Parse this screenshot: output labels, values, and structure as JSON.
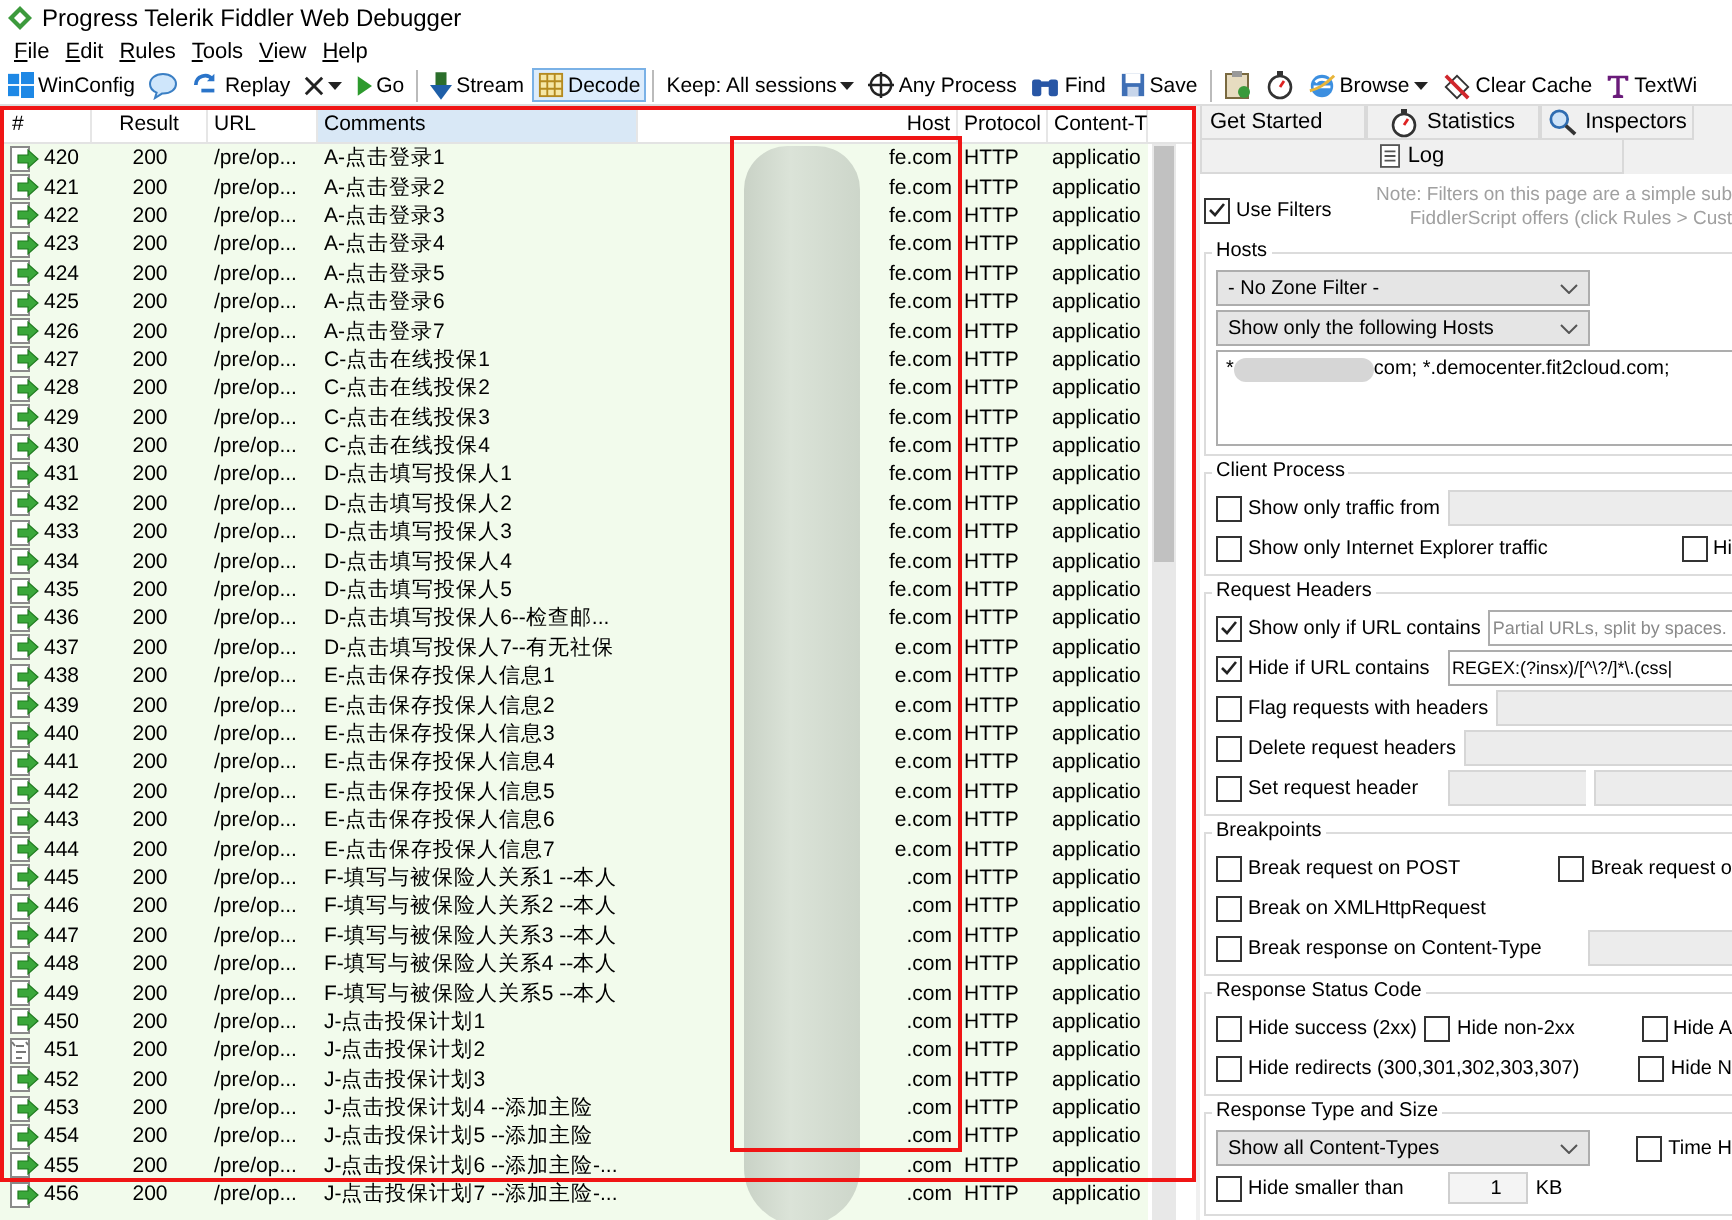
{
  "window": {
    "title": "Progress Telerik Fiddler Web Debugger"
  },
  "menu": [
    "File",
    "Edit",
    "Rules",
    "Tools",
    "View",
    "Help"
  ],
  "toolbar": [
    {
      "kind": "button",
      "label": "WinConfig",
      "dropdown": false,
      "selected": false
    },
    {
      "kind": "button",
      "dropdown": false,
      "selected": false
    },
    {
      "kind": "button",
      "label": "Replay",
      "dropdown": false,
      "selected": false
    },
    {
      "kind": "button",
      "dropdown": true,
      "selected": false
    },
    {
      "kind": "button",
      "label": "Go",
      "dropdown": false,
      "selected": false
    },
    {
      "kind": "separator"
    },
    {
      "kind": "button",
      "label": "Stream",
      "dropdown": false,
      "selected": false
    },
    {
      "kind": "button",
      "label": "Decode",
      "dropdown": false,
      "selected": true
    },
    {
      "kind": "separator"
    },
    {
      "kind": "button",
      "label": "Keep: All sessions",
      "dropdown": true,
      "selected": false
    },
    {
      "kind": "button",
      "label": "Any Process",
      "dropdown": false,
      "selected": false
    },
    {
      "kind": "button",
      "label": "Find",
      "dropdown": false,
      "selected": false
    },
    {
      "kind": "button",
      "label": "Save",
      "dropdown": false,
      "selected": false
    },
    {
      "kind": "separator"
    },
    {
      "kind": "button",
      "dropdown": false,
      "selected": false
    },
    {
      "kind": "button",
      "dropdown": false,
      "selected": false
    },
    {
      "kind": "button",
      "label": "Browse",
      "dropdown": true,
      "selected": false
    },
    {
      "kind": "button",
      "label": "Clear Cache",
      "dropdown": false,
      "selected": false
    },
    {
      "kind": "button",
      "label": "TextWi",
      "dropdown": false,
      "selected": false
    }
  ],
  "sessions": {
    "columns": [
      {
        "label": "#",
        "selected": false
      },
      {
        "label": "Result",
        "selected": false
      },
      {
        "label": "URL",
        "selected": false
      },
      {
        "label": "Comments",
        "selected": true
      },
      {
        "label": "Host",
        "selected": false
      },
      {
        "label": "Protocol",
        "selected": false
      },
      {
        "label": "Content-T",
        "selected": false
      }
    ],
    "rows": [
      {
        "kind": "arrow",
        "id": "420",
        "result": "200",
        "url": "/pre/op...",
        "comment": "A-点击登录1",
        "host": "fe.com",
        "protocol": "HTTP",
        "content_type": "applicatio"
      },
      {
        "kind": "arrow",
        "id": "421",
        "result": "200",
        "url": "/pre/op...",
        "comment": "A-点击登录2",
        "host": "fe.com",
        "protocol": "HTTP",
        "content_type": "applicatio"
      },
      {
        "kind": "arrow",
        "id": "422",
        "result": "200",
        "url": "/pre/op...",
        "comment": "A-点击登录3",
        "host": "fe.com",
        "protocol": "HTTP",
        "content_type": "applicatio"
      },
      {
        "kind": "arrow",
        "id": "423",
        "result": "200",
        "url": "/pre/op...",
        "comment": "A-点击登录4",
        "host": "fe.com",
        "protocol": "HTTP",
        "content_type": "applicatio"
      },
      {
        "kind": "arrow",
        "id": "424",
        "result": "200",
        "url": "/pre/op...",
        "comment": "A-点击登录5",
        "host": "fe.com",
        "protocol": "HTTP",
        "content_type": "applicatio"
      },
      {
        "kind": "arrow",
        "id": "425",
        "result": "200",
        "url": "/pre/op...",
        "comment": "A-点击登录6",
        "host": "fe.com",
        "protocol": "HTTP",
        "content_type": "applicatio"
      },
      {
        "kind": "arrow",
        "id": "426",
        "result": "200",
        "url": "/pre/op...",
        "comment": "A-点击登录7",
        "host": "fe.com",
        "protocol": "HTTP",
        "content_type": "applicatio"
      },
      {
        "kind": "arrow",
        "id": "427",
        "result": "200",
        "url": "/pre/op...",
        "comment": "C-点击在线投保1",
        "host": "fe.com",
        "protocol": "HTTP",
        "content_type": "applicatio"
      },
      {
        "kind": "arrow",
        "id": "428",
        "result": "200",
        "url": "/pre/op...",
        "comment": "C-点击在线投保2",
        "host": "fe.com",
        "protocol": "HTTP",
        "content_type": "applicatio"
      },
      {
        "kind": "arrow",
        "id": "429",
        "result": "200",
        "url": "/pre/op...",
        "comment": "C-点击在线投保3",
        "host": "fe.com",
        "protocol": "HTTP",
        "content_type": "applicatio"
      },
      {
        "kind": "arrow",
        "id": "430",
        "result": "200",
        "url": "/pre/op...",
        "comment": "C-点击在线投保4",
        "host": "fe.com",
        "protocol": "HTTP",
        "content_type": "applicatio"
      },
      {
        "kind": "arrow",
        "id": "431",
        "result": "200",
        "url": "/pre/op...",
        "comment": "D-点击填写投保人1",
        "host": "fe.com",
        "protocol": "HTTP",
        "content_type": "applicatio"
      },
      {
        "kind": "arrow",
        "id": "432",
        "result": "200",
        "url": "/pre/op...",
        "comment": "D-点击填写投保人2",
        "host": "fe.com",
        "protocol": "HTTP",
        "content_type": "applicatio"
      },
      {
        "kind": "arrow",
        "id": "433",
        "result": "200",
        "url": "/pre/op...",
        "comment": "D-点击填写投保人3",
        "host": "fe.com",
        "protocol": "HTTP",
        "content_type": "applicatio"
      },
      {
        "kind": "arrow",
        "id": "434",
        "result": "200",
        "url": "/pre/op...",
        "comment": "D-点击填写投保人4",
        "host": "fe.com",
        "protocol": "HTTP",
        "content_type": "applicatio"
      },
      {
        "kind": "arrow",
        "id": "435",
        "result": "200",
        "url": "/pre/op...",
        "comment": "D-点击填写投保人5",
        "host": "fe.com",
        "protocol": "HTTP",
        "content_type": "applicatio"
      },
      {
        "kind": "arrow",
        "id": "436",
        "result": "200",
        "url": "/pre/op...",
        "comment": "D-点击填写投保人6--检查邮...",
        "host": "fe.com",
        "protocol": "HTTP",
        "content_type": "applicatio"
      },
      {
        "kind": "arrow",
        "id": "437",
        "result": "200",
        "url": "/pre/op...",
        "comment": "D-点击填写投保人7--有无社保",
        "host": "e.com",
        "protocol": "HTTP",
        "content_type": "applicatio"
      },
      {
        "kind": "arrow",
        "id": "438",
        "result": "200",
        "url": "/pre/op...",
        "comment": "E-点击保存投保人信息1",
        "host": "e.com",
        "protocol": "HTTP",
        "content_type": "applicatio"
      },
      {
        "kind": "arrow",
        "id": "439",
        "result": "200",
        "url": "/pre/op...",
        "comment": "E-点击保存投保人信息2",
        "host": "e.com",
        "protocol": "HTTP",
        "content_type": "applicatio"
      },
      {
        "kind": "arrow",
        "id": "440",
        "result": "200",
        "url": "/pre/op...",
        "comment": "E-点击保存投保人信息3",
        "host": "e.com",
        "protocol": "HTTP",
        "content_type": "applicatio"
      },
      {
        "kind": "arrow",
        "id": "441",
        "result": "200",
        "url": "/pre/op...",
        "comment": "E-点击保存投保人信息4",
        "host": "e.com",
        "protocol": "HTTP",
        "content_type": "applicatio"
      },
      {
        "kind": "arrow",
        "id": "442",
        "result": "200",
        "url": "/pre/op...",
        "comment": "E-点击保存投保人信息5",
        "host": "e.com",
        "protocol": "HTTP",
        "content_type": "applicatio"
      },
      {
        "kind": "arrow",
        "id": "443",
        "result": "200",
        "url": "/pre/op...",
        "comment": "E-点击保存投保人信息6",
        "host": "e.com",
        "protocol": "HTTP",
        "content_type": "applicatio"
      },
      {
        "kind": "arrow",
        "id": "444",
        "result": "200",
        "url": "/pre/op...",
        "comment": "E-点击保存投保人信息7",
        "host": "e.com",
        "protocol": "HTTP",
        "content_type": "applicatio"
      },
      {
        "kind": "arrow",
        "id": "445",
        "result": "200",
        "url": "/pre/op...",
        "comment": "F-填写与被保险人关系1 --本人",
        "host": ".com",
        "protocol": "HTTP",
        "content_type": "applicatio"
      },
      {
        "kind": "arrow",
        "id": "446",
        "result": "200",
        "url": "/pre/op...",
        "comment": "F-填写与被保险人关系2 --本人",
        "host": ".com",
        "protocol": "HTTP",
        "content_type": "applicatio"
      },
      {
        "kind": "arrow",
        "id": "447",
        "result": "200",
        "url": "/pre/op...",
        "comment": "F-填写与被保险人关系3 --本人",
        "host": ".com",
        "protocol": "HTTP",
        "content_type": "applicatio"
      },
      {
        "kind": "arrow",
        "id": "448",
        "result": "200",
        "url": "/pre/op...",
        "comment": "F-填写与被保险人关系4 --本人",
        "host": ".com",
        "protocol": "HTTP",
        "content_type": "applicatio"
      },
      {
        "kind": "arrow",
        "id": "449",
        "result": "200",
        "url": "/pre/op...",
        "comment": "F-填写与被保险人关系5 --本人",
        "host": ".com",
        "protocol": "HTTP",
        "content_type": "applicatio"
      },
      {
        "kind": "arrow",
        "id": "450",
        "result": "200",
        "url": "/pre/op...",
        "comment": "J-点击投保计划1",
        "host": ".com",
        "protocol": "HTTP",
        "content_type": "applicatio"
      },
      {
        "kind": "script",
        "id": "451",
        "result": "200",
        "url": "/pre/op...",
        "comment": "J-点击投保计划2",
        "host": ".com",
        "protocol": "HTTP",
        "content_type": "applicatio"
      },
      {
        "kind": "arrow",
        "id": "452",
        "result": "200",
        "url": "/pre/op...",
        "comment": "J-点击投保计划3",
        "host": ".com",
        "protocol": "HTTP",
        "content_type": "applicatio"
      },
      {
        "kind": "arrow",
        "id": "453",
        "result": "200",
        "url": "/pre/op...",
        "comment": "J-点击投保计划4 --添加主险",
        "host": ".com",
        "protocol": "HTTP",
        "content_type": "applicatio"
      },
      {
        "kind": "arrow",
        "id": "454",
        "result": "200",
        "url": "/pre/op...",
        "comment": "J-点击投保计划5 --添加主险",
        "host": ".com",
        "protocol": "HTTP",
        "content_type": "applicatio"
      },
      {
        "kind": "arrow",
        "id": "455",
        "result": "200",
        "url": "/pre/op...",
        "comment": "J-点击投保计划6 --添加主险-...",
        "host": ".com",
        "protocol": "HTTP",
        "content_type": "applicatio"
      },
      {
        "kind": "arrow",
        "id": "456",
        "result": "200",
        "url": "/pre/op...",
        "comment": "J-点击投保计划7 --添加主险-...",
        "host": ".com",
        "protocol": "HTTP",
        "content_type": "applicatio"
      }
    ]
  },
  "inspector_tabs": [
    {
      "label": "Get Started"
    },
    {
      "label": "Statistics"
    },
    {
      "label": "Inspectors"
    },
    {
      "label": "Log"
    }
  ],
  "filters": {
    "use_filters": {
      "label": "Use Filters",
      "checked": true
    },
    "note": [
      "Note: Filters on this page are a simple sub",
      "FiddlerScript offers (click Rules > Cust"
    ],
    "groups": [
      {
        "title": "Hosts",
        "rows": [
          {
            "left": [
              {
                "kind": "select",
                "value": "- No Zone Filter -"
              }
            ]
          },
          {
            "left": [
              {
                "kind": "select",
                "value": "Show only the following Hosts"
              }
            ]
          },
          {
            "left": [
              {
                "kind": "textarea",
                "parts": [
                  "*",
                  "com; *.democenter.fit2cloud.com;"
                ]
              }
            ]
          }
        ]
      },
      {
        "title": "Client Process",
        "rows": [
          {
            "left": [
              {
                "kind": "checkbox",
                "label": "Show only traffic from",
                "checked": false
              },
              {
                "kind": "input",
                "disabled": true
              }
            ]
          },
          {
            "left": [
              {
                "kind": "checkbox",
                "label": "Show only Internet Explorer traffic",
                "checked": false
              }
            ],
            "right": [
              {
                "kind": "checkbox",
                "label": "Hi",
                "checked": false
              }
            ]
          }
        ]
      },
      {
        "title": "Request Headers",
        "rows": [
          {
            "left": [
              {
                "kind": "checkbox",
                "label": "Show only if URL contains",
                "checked": true
              },
              {
                "kind": "input",
                "placeholder": "Partial URLs, split by spaces.",
                "disabled": false
              }
            ]
          },
          {
            "left": [
              {
                "kind": "checkbox",
                "label": "Hide if URL contains",
                "checked": true
              },
              {
                "kind": "input",
                "value": "REGEX:(?insx)/[^\\?/]*\\.(css|",
                "disabled": false
              }
            ]
          },
          {
            "left": [
              {
                "kind": "checkbox",
                "label": "Flag requests with headers",
                "checked": false
              },
              {
                "kind": "input",
                "disabled": true
              }
            ]
          },
          {
            "left": [
              {
                "kind": "checkbox",
                "label": "Delete request headers",
                "checked": false
              },
              {
                "kind": "input",
                "disabled": true
              }
            ]
          },
          {
            "left": [
              {
                "kind": "checkbox",
                "label": "Set request header",
                "checked": false
              },
              {
                "kind": "input",
                "disabled": true
              },
              {
                "kind": "input",
                "disabled": true
              }
            ]
          }
        ]
      },
      {
        "title": "Breakpoints",
        "rows": [
          {
            "left": [
              {
                "kind": "checkbox",
                "label": "Break request on POST",
                "checked": false
              }
            ],
            "right": [
              {
                "kind": "checkbox",
                "label": "Break request o",
                "checked": false
              }
            ]
          },
          {
            "left": [
              {
                "kind": "checkbox",
                "label": "Break on XMLHttpRequest",
                "checked": false
              }
            ]
          },
          {
            "left": [
              {
                "kind": "checkbox",
                "label": "Break response on Content-Type",
                "checked": false
              }
            ],
            "right": [
              {
                "kind": "input",
                "disabled": true
              }
            ]
          }
        ]
      },
      {
        "title": "Response Status Code",
        "rows": [
          {
            "left": [
              {
                "kind": "checkbox",
                "label": "Hide success (2xx)",
                "checked": false
              },
              {
                "kind": "checkbox",
                "label": "Hide non-2xx",
                "checked": false
              }
            ],
            "right": [
              {
                "kind": "checkbox",
                "label": "Hide A",
                "checked": false
              }
            ]
          },
          {
            "left": [
              {
                "kind": "checkbox",
                "label": "Hide redirects (300,301,302,303,307)",
                "checked": false
              }
            ],
            "right": [
              {
                "kind": "checkbox",
                "label": "Hide N",
                "checked": false
              }
            ]
          }
        ]
      },
      {
        "title": "Response Type and Size",
        "rows": [
          {
            "left": [
              {
                "kind": "select",
                "value": "Show all Content-Types"
              }
            ],
            "right": [
              {
                "kind": "checkbox",
                "label": "Time H",
                "checked": false
              }
            ]
          },
          {
            "left": [
              {
                "kind": "checkbox",
                "label": "Hide smaller than",
                "checked": false
              },
              {
                "kind": "spinner",
                "value": "1"
              },
              {
                "kind": "unit",
                "label": "KB"
              }
            ]
          }
        ]
      }
    ]
  }
}
